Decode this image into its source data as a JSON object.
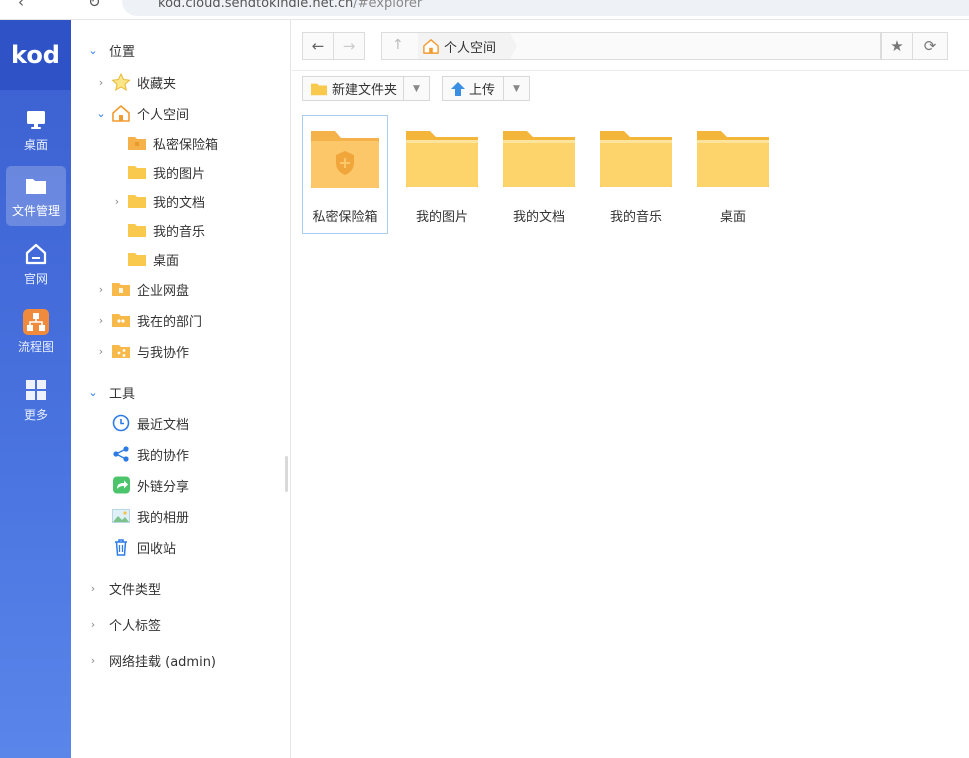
{
  "browser": {
    "back_glyph": "‹",
    "reload_glyph": "↻",
    "url_main": "kod.cloud.sendtokindle.net.cn",
    "url_path": "/#explorer"
  },
  "rail": {
    "logo": "kod",
    "items": [
      {
        "label": "桌面",
        "icon": "monitor-icon"
      },
      {
        "label": "文件管理",
        "icon": "folder-icon"
      },
      {
        "label": "官网",
        "icon": "home-icon"
      },
      {
        "label": "流程图",
        "icon": "flowchart-icon"
      },
      {
        "label": "更多",
        "icon": "grid-icon"
      }
    ]
  },
  "sidebar": {
    "location_title": "位置",
    "favorites": "收藏夹",
    "personal_space": "个人空间",
    "personal_children": [
      "私密保险箱",
      "我的图片",
      "我的文档",
      "我的音乐",
      "桌面"
    ],
    "enterprise_disk": "企业网盘",
    "my_department": "我在的部门",
    "shared_with_me": "与我协作",
    "tools_title": "工具",
    "tools": [
      "最近文档",
      "我的协作",
      "外链分享",
      "我的相册",
      "回收站"
    ],
    "file_types": "文件类型",
    "personal_tags": "个人标签",
    "network_mount": "网络挂载 (admin)"
  },
  "pathbar": {
    "back": "←",
    "forward": "→",
    "up": "↑",
    "crumb": "个人空间",
    "star": "★",
    "refresh": "⟳"
  },
  "toolbar": {
    "new_folder": "新建文件夹",
    "upload": "上传",
    "dropdown": "▼"
  },
  "files": [
    {
      "name": "私密保险箱",
      "type": "vault"
    },
    {
      "name": "我的图片",
      "type": "folder"
    },
    {
      "name": "我的文档",
      "type": "folder"
    },
    {
      "name": "我的音乐",
      "type": "folder"
    },
    {
      "name": "桌面",
      "type": "folder"
    }
  ],
  "colors": {
    "rail_top": "#2f53c6",
    "accent": "#2d7be5",
    "folder": "#f9c94e",
    "vault": "#f6b24a"
  }
}
